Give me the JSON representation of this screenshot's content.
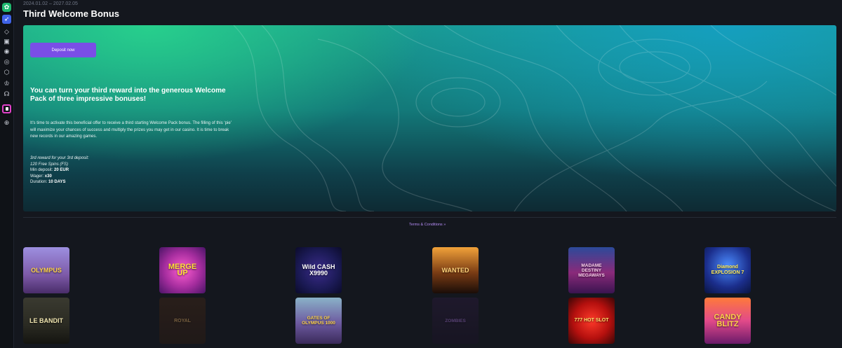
{
  "sidebar": {
    "icons": [
      "logo-icon",
      "rocket-icon",
      "diamond-icon",
      "cake-icon",
      "shield-icon",
      "target-icon",
      "tag-icon",
      "crown-icon",
      "headset-icon",
      "promo-icon",
      "globe-icon"
    ]
  },
  "header": {
    "dates": "2024.01.02 – 2027.02.05",
    "title": "Third Welcome Bonus"
  },
  "banner": {
    "deposit_button": "Deposit now",
    "headline": "You can turn your third reward into the generous Welcome Pack of three impressive bonuses!",
    "description": "It’s time to activate this beneficial offer to receive a third starting Welcome Pack bonus. The filling of this ‘pie’ will maximize your chances of success and multiply the prizes you may get in our casino. It is time to break new records in our amazing games.",
    "reward_line1": "3rd reward for your 3rd deposit:",
    "reward_line2": "120 Free Spins (FS)",
    "min_deposit_label": "Min deposit: ",
    "min_deposit_value": "20 EUR",
    "wager_label": "Wager: ",
    "wager_value": "x30",
    "duration_label": "Duration: ",
    "duration_value": "10 DAYS"
  },
  "terms": {
    "label": "Terms & Conditions",
    "arrow": "»"
  },
  "games": [
    {
      "title": "OLYMPUS"
    },
    {
      "title": "MERGE UP"
    },
    {
      "title": "Wild CASH X9990"
    },
    {
      "title": "WANTED"
    },
    {
      "title": "MADAME DESTINY MEGAWAYS"
    },
    {
      "title": "Diamond EXPLOSION 7"
    },
    {
      "title": "LE BANDIT"
    },
    {
      "title": "ROYAL"
    },
    {
      "title": "GATES OF OLYMPUS 1000"
    },
    {
      "title": "ZOMBIES"
    },
    {
      "title": "777 HOT SLOT"
    },
    {
      "title": "CANDY BLITZ"
    }
  ]
}
